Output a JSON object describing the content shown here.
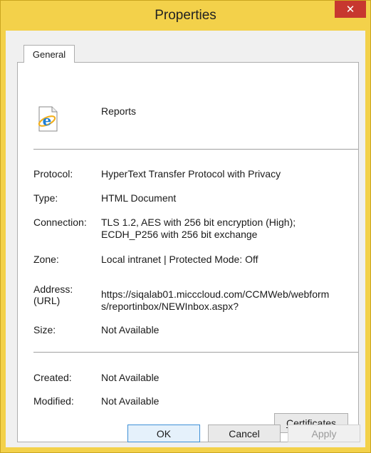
{
  "window": {
    "title": "Properties",
    "close_glyph": "✕"
  },
  "tabs": [
    {
      "label": "General"
    }
  ],
  "general": {
    "name": "Reports",
    "fields": {
      "protocol": {
        "label": "Protocol:",
        "value": "HyperText Transfer Protocol with Privacy"
      },
      "type": {
        "label": "Type:",
        "value": "HTML Document"
      },
      "connection": {
        "label": "Connection:",
        "value_line1": "TLS 1.2, AES with 256 bit encryption (High);",
        "value_line2": "ECDH_P256 with 256 bit exchange"
      },
      "zone": {
        "label": "Zone:",
        "value": "Local intranet | Protected Mode: Off"
      },
      "address": {
        "label_line1": "Address:",
        "label_line2": "(URL)",
        "value_line1": "https://siqalab01.micccloud.com/CCMWeb/webform",
        "value_line2": "s/reportinbox/NEWInbox.aspx?"
      },
      "size": {
        "label": "Size:",
        "value": "Not Available"
      },
      "created": {
        "label": "Created:",
        "value": "Not Available"
      },
      "modified": {
        "label": "Modified:",
        "value": "Not Available"
      }
    },
    "certificates_label_accel": "C",
    "certificates_label_rest": "ertificates"
  },
  "buttons": {
    "ok": "OK",
    "cancel": "Cancel",
    "apply": "Apply"
  },
  "colors": {
    "titlebar": "#f3d14a",
    "close": "#c7372f",
    "ok_border": "#3d8fd6"
  },
  "icons": {
    "document": "ie-document-icon"
  }
}
